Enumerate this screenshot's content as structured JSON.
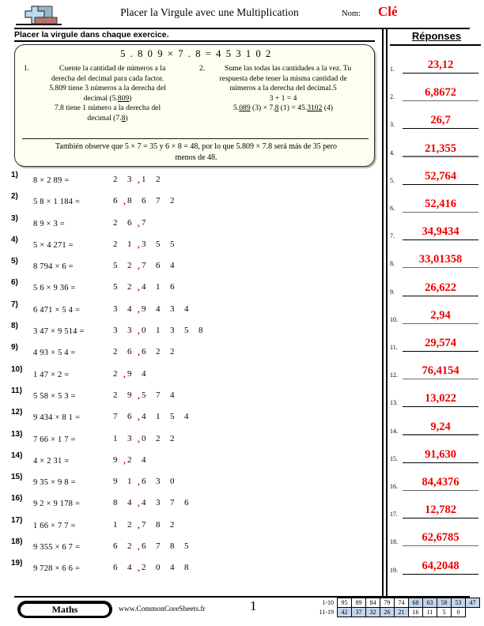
{
  "header": {
    "title": "Placer la Virgule avec une Multiplication",
    "name_label": "Nom:",
    "name_value": "Clé",
    "logo_icon": "plus-block-logo"
  },
  "instructions": {
    "subheading": "Placer la virgule dans chaque exercice.",
    "example_equation": "5 . 8 0 9   ×   7 . 8   =   4  5  3  1  0  2",
    "step1": {
      "number": "1.",
      "line1": "Cuente la cantidad de números a la",
      "line2": "derecha del decimal para cada factor.",
      "line3_a": "5.809 tiene 3 números a la derecha del",
      "line3_b": "decimal (5.",
      "line3_u": "809",
      "line3_c": ")",
      "line4_a": "7.8 tiene 1 número a la derecha del",
      "line4_b": "decimal (7.",
      "line4_u": "8",
      "line4_c": ")"
    },
    "step2": {
      "number": "2.",
      "line1": "Sume las todas las cantidades a la vez. Tu",
      "line2": "respuesta debe tener la misma cantidad de",
      "line3": "números a la derecha del decimal.5",
      "line4": "3 + 1 = 4",
      "line5_a": "5.",
      "line5_u1": "089",
      "line5_b": " (3) × 7.",
      "line5_u2": "8",
      "line5_c": " (1) = 45.",
      "line5_u3": "3102",
      "line5_d": " (4)"
    },
    "note_line1": "También observe que 5 × 7 = 35 y 6 × 8 = 48, por lo que 5.809 × 7.8 será más de 35 pero",
    "note_line2": "menos de 48."
  },
  "problems": [
    {
      "num": "1)",
      "expression": "8 × 2 89 =",
      "digits": [
        "2",
        "3",
        "1",
        "2"
      ],
      "comma_after": 2
    },
    {
      "num": "2)",
      "expression": "5 8 × 1 184 =",
      "digits": [
        "6",
        "8",
        "6",
        "7",
        "2"
      ],
      "comma_after": 1
    },
    {
      "num": "3)",
      "expression": "8 9 × 3 =",
      "digits": [
        "2",
        "6",
        "7"
      ],
      "comma_after": 2
    },
    {
      "num": "4)",
      "expression": "5 × 4 271 =",
      "digits": [
        "2",
        "1",
        "3",
        "5",
        "5"
      ],
      "comma_after": 2
    },
    {
      "num": "5)",
      "expression": "8 794 × 6 =",
      "digits": [
        "5",
        "2",
        "7",
        "6",
        "4"
      ],
      "comma_after": 2
    },
    {
      "num": "6)",
      "expression": "5 6 × 9 36 =",
      "digits": [
        "5",
        "2",
        "4",
        "1",
        "6"
      ],
      "comma_after": 2
    },
    {
      "num": "7)",
      "expression": "6 471 × 5 4 =",
      "digits": [
        "3",
        "4",
        "9",
        "4",
        "3",
        "4"
      ],
      "comma_after": 2
    },
    {
      "num": "8)",
      "expression": "3 47 × 9 514 =",
      "digits": [
        "3",
        "3",
        "0",
        "1",
        "3",
        "5",
        "8"
      ],
      "comma_after": 2
    },
    {
      "num": "9)",
      "expression": "4 93 × 5 4 =",
      "digits": [
        "2",
        "6",
        "6",
        "2",
        "2"
      ],
      "comma_after": 2
    },
    {
      "num": "10)",
      "expression": "1 47 × 2 =",
      "digits": [
        "2",
        "9",
        "4"
      ],
      "comma_after": 1
    },
    {
      "num": "11)",
      "expression": "5 58 × 5 3 =",
      "digits": [
        "2",
        "9",
        "5",
        "7",
        "4"
      ],
      "comma_after": 2
    },
    {
      "num": "12)",
      "expression": "9 434 × 8 1 =",
      "digits": [
        "7",
        "6",
        "4",
        "1",
        "5",
        "4"
      ],
      "comma_after": 2
    },
    {
      "num": "13)",
      "expression": "7 66 × 1 7 =",
      "digits": [
        "1",
        "3",
        "0",
        "2",
        "2"
      ],
      "comma_after": 2
    },
    {
      "num": "14)",
      "expression": "4 × 2 31 =",
      "digits": [
        "9",
        "2",
        "4"
      ],
      "comma_after": 1
    },
    {
      "num": "15)",
      "expression": "9 35 × 9 8 =",
      "digits": [
        "9",
        "1",
        "6",
        "3",
        "0"
      ],
      "comma_after": 2
    },
    {
      "num": "16)",
      "expression": "9 2 × 9 178 =",
      "digits": [
        "8",
        "4",
        "4",
        "3",
        "7",
        "6"
      ],
      "comma_after": 2
    },
    {
      "num": "17)",
      "expression": "1 66 × 7 7 =",
      "digits": [
        "1",
        "2",
        "7",
        "8",
        "2"
      ],
      "comma_after": 2
    },
    {
      "num": "18)",
      "expression": "9 355 × 6 7 =",
      "digits": [
        "6",
        "2",
        "6",
        "7",
        "8",
        "5"
      ],
      "comma_after": 2
    },
    {
      "num": "19)",
      "expression": "9 728 × 6 6 =",
      "digits": [
        "6",
        "4",
        "2",
        "0",
        "4",
        "8"
      ],
      "comma_after": 2
    }
  ],
  "answers": {
    "title": "Réponses",
    "items": [
      {
        "num": "1.",
        "value": "23,12"
      },
      {
        "num": "2.",
        "value": "6,8672"
      },
      {
        "num": "3.",
        "value": "26,7"
      },
      {
        "num": "4.",
        "value": "21,355"
      },
      {
        "num": "5.",
        "value": "52,764"
      },
      {
        "num": "6.",
        "value": "52,416"
      },
      {
        "num": "7.",
        "value": "34,9434"
      },
      {
        "num": "8.",
        "value": "33,01358"
      },
      {
        "num": "9.",
        "value": "26,622"
      },
      {
        "num": "10.",
        "value": "2,94"
      },
      {
        "num": "11.",
        "value": "29,574"
      },
      {
        "num": "12.",
        "value": "76,4154"
      },
      {
        "num": "13.",
        "value": "13,022"
      },
      {
        "num": "14.",
        "value": "9,24"
      },
      {
        "num": "15.",
        "value": "91,630"
      },
      {
        "num": "16.",
        "value": "84,4376"
      },
      {
        "num": "17.",
        "value": "12,782"
      },
      {
        "num": "18.",
        "value": "62,6785"
      },
      {
        "num": "19.",
        "value": "64,2048"
      }
    ],
    "answer_color": "#ee0000"
  },
  "footer": {
    "subject_badge": "Maths",
    "website": "www.CommonCoreSheets.fr",
    "page_number": "1",
    "scale": {
      "row1_label": "1-10",
      "row2_label": "11-19",
      "row1": [
        {
          "v": "95",
          "hl": false
        },
        {
          "v": "89",
          "hl": false
        },
        {
          "v": "84",
          "hl": false
        },
        {
          "v": "79",
          "hl": false
        },
        {
          "v": "74",
          "hl": false
        },
        {
          "v": "68",
          "hl": true
        },
        {
          "v": "63",
          "hl": true
        },
        {
          "v": "58",
          "hl": true
        },
        {
          "v": "53",
          "hl": true
        },
        {
          "v": "47",
          "hl": true
        }
      ],
      "row2": [
        {
          "v": "42",
          "hl": true
        },
        {
          "v": "37",
          "hl": true
        },
        {
          "v": "32",
          "hl": true
        },
        {
          "v": "26",
          "hl": true
        },
        {
          "v": "21",
          "hl": true
        },
        {
          "v": "16",
          "hl": false
        },
        {
          "v": "11",
          "hl": false
        },
        {
          "v": "5",
          "hl": false
        },
        {
          "v": "0",
          "hl": false
        }
      ],
      "highlight_color": "#c5d5ee"
    }
  }
}
